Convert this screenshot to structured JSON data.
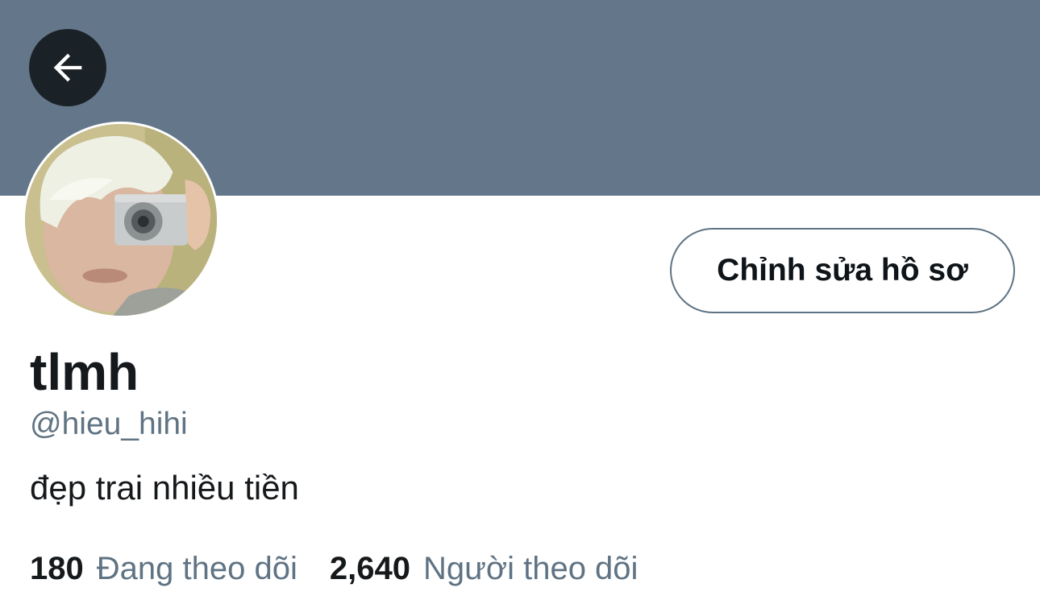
{
  "profile": {
    "banner_color": "#64778a",
    "display_name": "tlmh",
    "handle": "@hieu_hihi",
    "bio": "đẹp trai nhiều tiền",
    "edit_button_label": "Chỉnh sửa hồ sơ",
    "back_icon": "arrow-left-icon",
    "avatar": "profile photo"
  },
  "stats": {
    "following_count": "180",
    "following_label": "Đang theo dõi",
    "followers_count": "2,640",
    "followers_label": "Người theo dõi"
  }
}
